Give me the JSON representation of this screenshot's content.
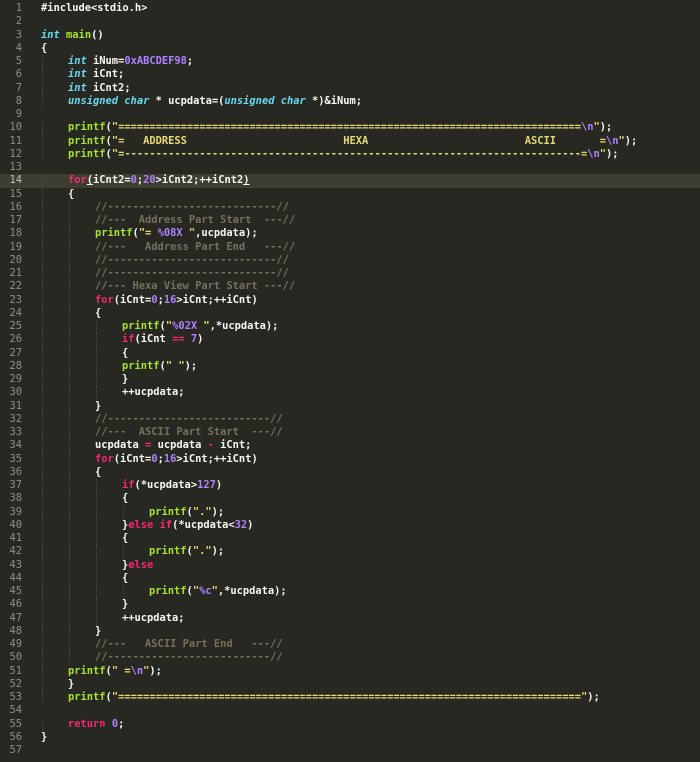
{
  "editor": {
    "theme_colors": {
      "background": "#272822",
      "keyword": "#f92672",
      "type": "#66d9ef",
      "function": "#a6e22e",
      "number": "#ae81ff",
      "string": "#e6db74",
      "comment": "#75715e",
      "text": "#f8f8f2"
    },
    "current_line": 14,
    "lines": [
      {
        "n": "1",
        "indent": 0,
        "t": [
          {
            "c": "pl",
            "v": "#include<stdio.h>"
          }
        ]
      },
      {
        "n": "2",
        "indent": 0,
        "t": []
      },
      {
        "n": "3",
        "indent": 0,
        "t": [
          {
            "c": "ty",
            "v": "int"
          },
          {
            "c": "pl",
            "v": " "
          },
          {
            "c": "fn",
            "v": "main"
          },
          {
            "c": "pl",
            "v": "()"
          }
        ]
      },
      {
        "n": "4",
        "indent": 0,
        "t": [
          {
            "c": "pl",
            "v": "{"
          }
        ]
      },
      {
        "n": "5",
        "indent": 1,
        "t": [
          {
            "c": "ty",
            "v": "int"
          },
          {
            "c": "pl",
            "v": " iNum="
          },
          {
            "c": "nm",
            "v": "0xABCDEF98"
          },
          {
            "c": "pl",
            "v": ";"
          }
        ]
      },
      {
        "n": "6",
        "indent": 1,
        "t": [
          {
            "c": "ty",
            "v": "int"
          },
          {
            "c": "pl",
            "v": " iCnt;"
          }
        ]
      },
      {
        "n": "7",
        "indent": 1,
        "t": [
          {
            "c": "ty",
            "v": "int"
          },
          {
            "c": "pl",
            "v": " iCnt2;"
          }
        ]
      },
      {
        "n": "8",
        "indent": 1,
        "t": [
          {
            "c": "ty",
            "v": "unsigned char"
          },
          {
            "c": "pl",
            "v": " * ucpdata=("
          },
          {
            "c": "ty",
            "v": "unsigned char"
          },
          {
            "c": "pl",
            "v": " *)&iNum;"
          }
        ]
      },
      {
        "n": "9",
        "indent": 0,
        "t": []
      },
      {
        "n": "10",
        "indent": 1,
        "t": [
          {
            "c": "fn",
            "v": "printf"
          },
          {
            "c": "pl",
            "v": "("
          },
          {
            "c": "st",
            "v": "\"=========================================================================="
          },
          {
            "c": "fmt",
            "v": "\\n"
          },
          {
            "c": "st",
            "v": "\""
          },
          {
            "c": "pl",
            "v": ");"
          }
        ]
      },
      {
        "n": "11",
        "indent": 1,
        "t": [
          {
            "c": "fn",
            "v": "printf"
          },
          {
            "c": "pl",
            "v": "("
          },
          {
            "c": "st",
            "v": "\"=   ADDRESS                         HEXA                         ASCII       ="
          },
          {
            "c": "fmt",
            "v": "\\n"
          },
          {
            "c": "st",
            "v": "\""
          },
          {
            "c": "pl",
            "v": ");"
          }
        ]
      },
      {
        "n": "12",
        "indent": 1,
        "t": [
          {
            "c": "fn",
            "v": "printf"
          },
          {
            "c": "pl",
            "v": "("
          },
          {
            "c": "st",
            "v": "\"=-------------------------------------------------------------------------="
          },
          {
            "c": "fmt",
            "v": "\\n"
          },
          {
            "c": "st",
            "v": "\""
          },
          {
            "c": "pl",
            "v": ");"
          }
        ]
      },
      {
        "n": "13",
        "indent": 0,
        "t": []
      },
      {
        "n": "14",
        "indent": 1,
        "t": [
          {
            "c": "kw",
            "v": "for"
          },
          {
            "c": "pl und",
            "v": "("
          },
          {
            "c": "pl",
            "v": "iCnt2="
          },
          {
            "c": "nm",
            "v": "0"
          },
          {
            "c": "pl",
            "v": ";"
          },
          {
            "c": "nm",
            "v": "20"
          },
          {
            "c": "pl",
            "v": ">iCnt2;++iCnt2"
          },
          {
            "c": "pl und",
            "v": ")"
          }
        ]
      },
      {
        "n": "15",
        "indent": 1,
        "t": [
          {
            "c": "pl",
            "v": "{"
          }
        ]
      },
      {
        "n": "16",
        "indent": 2,
        "t": [
          {
            "c": "co",
            "v": "//---------------------------//"
          }
        ]
      },
      {
        "n": "17",
        "indent": 2,
        "t": [
          {
            "c": "co",
            "v": "//---  Address Part Start  ---//"
          }
        ]
      },
      {
        "n": "18",
        "indent": 2,
        "t": [
          {
            "c": "fn",
            "v": "printf"
          },
          {
            "c": "pl",
            "v": "("
          },
          {
            "c": "st",
            "v": "\"= "
          },
          {
            "c": "fmt",
            "v": "%08X"
          },
          {
            "c": "st",
            "v": " \""
          },
          {
            "c": "pl",
            "v": ",ucpdata);"
          }
        ]
      },
      {
        "n": "19",
        "indent": 2,
        "t": [
          {
            "c": "co",
            "v": "//---   Address Part End   ---//"
          }
        ]
      },
      {
        "n": "20",
        "indent": 2,
        "t": [
          {
            "c": "co",
            "v": "//---------------------------//"
          }
        ]
      },
      {
        "n": "21",
        "indent": 2,
        "t": [
          {
            "c": "co",
            "v": "//---------------------------//"
          }
        ]
      },
      {
        "n": "22",
        "indent": 2,
        "t": [
          {
            "c": "co",
            "v": "//--- Hexa View Part Start ---//"
          }
        ]
      },
      {
        "n": "23",
        "indent": 2,
        "t": [
          {
            "c": "kw",
            "v": "for"
          },
          {
            "c": "pl",
            "v": "(iCnt="
          },
          {
            "c": "nm",
            "v": "0"
          },
          {
            "c": "pl",
            "v": ";"
          },
          {
            "c": "nm",
            "v": "16"
          },
          {
            "c": "pl",
            "v": ">iCnt;++iCnt)"
          }
        ]
      },
      {
        "n": "24",
        "indent": 2,
        "t": [
          {
            "c": "pl",
            "v": "{"
          }
        ]
      },
      {
        "n": "25",
        "indent": 3,
        "t": [
          {
            "c": "fn",
            "v": "printf"
          },
          {
            "c": "pl",
            "v": "("
          },
          {
            "c": "st",
            "v": "\""
          },
          {
            "c": "fmt",
            "v": "%02X"
          },
          {
            "c": "st",
            "v": " \""
          },
          {
            "c": "pl",
            "v": ",*ucpdata);"
          }
        ]
      },
      {
        "n": "26",
        "indent": 3,
        "t": [
          {
            "c": "kw",
            "v": "if"
          },
          {
            "c": "pl",
            "v": "(iCnt "
          },
          {
            "c": "kw",
            "v": "=="
          },
          {
            "c": "pl",
            "v": " "
          },
          {
            "c": "nm",
            "v": "7"
          },
          {
            "c": "pl",
            "v": ")"
          }
        ]
      },
      {
        "n": "27",
        "indent": 3,
        "t": [
          {
            "c": "pl",
            "v": "{"
          }
        ]
      },
      {
        "n": "28",
        "indent": 3,
        "t": [
          {
            "c": "fn",
            "v": "printf"
          },
          {
            "c": "pl",
            "v": "("
          },
          {
            "c": "st",
            "v": "\" \""
          },
          {
            "c": "pl",
            "v": ");"
          }
        ]
      },
      {
        "n": "29",
        "indent": 3,
        "t": [
          {
            "c": "pl",
            "v": "}"
          }
        ]
      },
      {
        "n": "30",
        "indent": 3,
        "t": [
          {
            "c": "pl",
            "v": "++ucpdata;"
          }
        ]
      },
      {
        "n": "31",
        "indent": 2,
        "t": [
          {
            "c": "pl",
            "v": "}"
          }
        ]
      },
      {
        "n": "32",
        "indent": 2,
        "t": [
          {
            "c": "co",
            "v": "//--------------------------//"
          }
        ]
      },
      {
        "n": "33",
        "indent": 2,
        "t": [
          {
            "c": "co",
            "v": "//---  ASCII Part Start  ---//"
          }
        ]
      },
      {
        "n": "34",
        "indent": 2,
        "t": [
          {
            "c": "pl",
            "v": "ucpdata "
          },
          {
            "c": "kw",
            "v": "="
          },
          {
            "c": "pl",
            "v": " ucpdata "
          },
          {
            "c": "kw",
            "v": "-"
          },
          {
            "c": "pl",
            "v": " iCnt;"
          }
        ]
      },
      {
        "n": "35",
        "indent": 2,
        "t": [
          {
            "c": "kw",
            "v": "for"
          },
          {
            "c": "pl",
            "v": "(iCnt="
          },
          {
            "c": "nm",
            "v": "0"
          },
          {
            "c": "pl",
            "v": ";"
          },
          {
            "c": "nm",
            "v": "16"
          },
          {
            "c": "pl",
            "v": ">iCnt;++iCnt)"
          }
        ]
      },
      {
        "n": "36",
        "indent": 2,
        "t": [
          {
            "c": "pl",
            "v": "{"
          }
        ]
      },
      {
        "n": "37",
        "indent": 3,
        "t": [
          {
            "c": "kw",
            "v": "if"
          },
          {
            "c": "pl",
            "v": "(*ucpdata>"
          },
          {
            "c": "nm",
            "v": "127"
          },
          {
            "c": "pl",
            "v": ")"
          }
        ]
      },
      {
        "n": "38",
        "indent": 3,
        "t": [
          {
            "c": "pl",
            "v": "{"
          }
        ]
      },
      {
        "n": "39",
        "indent": 4,
        "t": [
          {
            "c": "fn",
            "v": "printf"
          },
          {
            "c": "pl",
            "v": "("
          },
          {
            "c": "st",
            "v": "\".\""
          },
          {
            "c": "pl",
            "v": ");"
          }
        ]
      },
      {
        "n": "40",
        "indent": 3,
        "t": [
          {
            "c": "pl",
            "v": "}"
          },
          {
            "c": "kw",
            "v": "else if"
          },
          {
            "c": "pl",
            "v": "(*ucpdata<"
          },
          {
            "c": "nm",
            "v": "32"
          },
          {
            "c": "pl",
            "v": ")"
          }
        ]
      },
      {
        "n": "41",
        "indent": 3,
        "t": [
          {
            "c": "pl",
            "v": "{"
          }
        ]
      },
      {
        "n": "42",
        "indent": 4,
        "t": [
          {
            "c": "fn",
            "v": "printf"
          },
          {
            "c": "pl",
            "v": "("
          },
          {
            "c": "st",
            "v": "\".\""
          },
          {
            "c": "pl",
            "v": ");"
          }
        ]
      },
      {
        "n": "43",
        "indent": 3,
        "t": [
          {
            "c": "pl",
            "v": "}"
          },
          {
            "c": "kw",
            "v": "else"
          }
        ]
      },
      {
        "n": "44",
        "indent": 3,
        "t": [
          {
            "c": "pl",
            "v": "{"
          }
        ]
      },
      {
        "n": "45",
        "indent": 4,
        "t": [
          {
            "c": "fn",
            "v": "printf"
          },
          {
            "c": "pl",
            "v": "("
          },
          {
            "c": "st",
            "v": "\""
          },
          {
            "c": "fmt",
            "v": "%c"
          },
          {
            "c": "st",
            "v": "\""
          },
          {
            "c": "pl",
            "v": ",*ucpdata);"
          }
        ]
      },
      {
        "n": "46",
        "indent": 3,
        "t": [
          {
            "c": "pl",
            "v": "}"
          }
        ]
      },
      {
        "n": "47",
        "indent": 3,
        "t": [
          {
            "c": "pl",
            "v": "++ucpdata;"
          }
        ]
      },
      {
        "n": "48",
        "indent": 2,
        "t": [
          {
            "c": "pl",
            "v": "}"
          }
        ]
      },
      {
        "n": "49",
        "indent": 2,
        "t": [
          {
            "c": "co",
            "v": "//---   ASCII Part End   ---//"
          }
        ]
      },
      {
        "n": "50",
        "indent": 2,
        "t": [
          {
            "c": "co",
            "v": "//--------------------------//"
          }
        ]
      },
      {
        "n": "51",
        "indent": 1,
        "t": [
          {
            "c": "fn",
            "v": "printf"
          },
          {
            "c": "pl",
            "v": "("
          },
          {
            "c": "st",
            "v": "\" ="
          },
          {
            "c": "fmt",
            "v": "\\n"
          },
          {
            "c": "st",
            "v": "\""
          },
          {
            "c": "pl",
            "v": ");"
          }
        ]
      },
      {
        "n": "52",
        "indent": 1,
        "t": [
          {
            "c": "pl",
            "v": "}"
          }
        ]
      },
      {
        "n": "53",
        "indent": 1,
        "t": [
          {
            "c": "fn",
            "v": "printf"
          },
          {
            "c": "pl",
            "v": "("
          },
          {
            "c": "st",
            "v": "\"==========================================================================\""
          },
          {
            "c": "pl",
            "v": ");"
          }
        ]
      },
      {
        "n": "54",
        "indent": 0,
        "t": []
      },
      {
        "n": "55",
        "indent": 1,
        "t": [
          {
            "c": "kw",
            "v": "return"
          },
          {
            "c": "pl",
            "v": " "
          },
          {
            "c": "nm",
            "v": "0"
          },
          {
            "c": "pl",
            "v": ";"
          }
        ]
      },
      {
        "n": "56",
        "indent": 0,
        "t": [
          {
            "c": "pl",
            "v": "}"
          }
        ]
      },
      {
        "n": "57",
        "indent": 0,
        "t": []
      }
    ]
  }
}
